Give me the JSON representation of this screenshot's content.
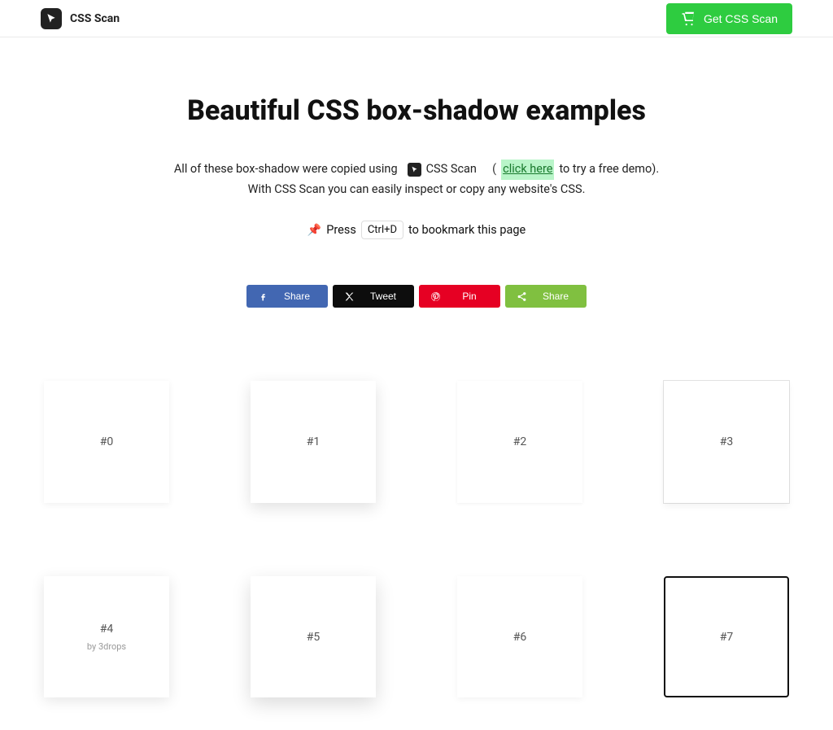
{
  "header": {
    "brand": "CSS Scan",
    "cta_label": "Get CSS Scan"
  },
  "hero": {
    "title": "Beautiful CSS box-shadow examples",
    "line1_prefix": "All of these box-shadow were copied using",
    "css_scan_label": "CSS Scan",
    "paren_open": "(",
    "demo_link_text": "click here",
    "line1_suffix": "to try a free demo).",
    "line2": "With CSS Scan you can easily inspect or copy any website's CSS.",
    "bookmark_press": "Press",
    "bookmark_key": "Ctrl+D",
    "bookmark_suffix": "to bookmark this page"
  },
  "share": {
    "facebook": "Share",
    "twitter": "Tweet",
    "pinterest": "Pin",
    "sharethis": "Share"
  },
  "cards": {
    "c0": "#0",
    "c1": "#1",
    "c2": "#2",
    "c3": "#3",
    "c4": "#4",
    "c4_sub": "by 3drops",
    "c5": "#5",
    "c6": "#6",
    "c7": "#7"
  }
}
